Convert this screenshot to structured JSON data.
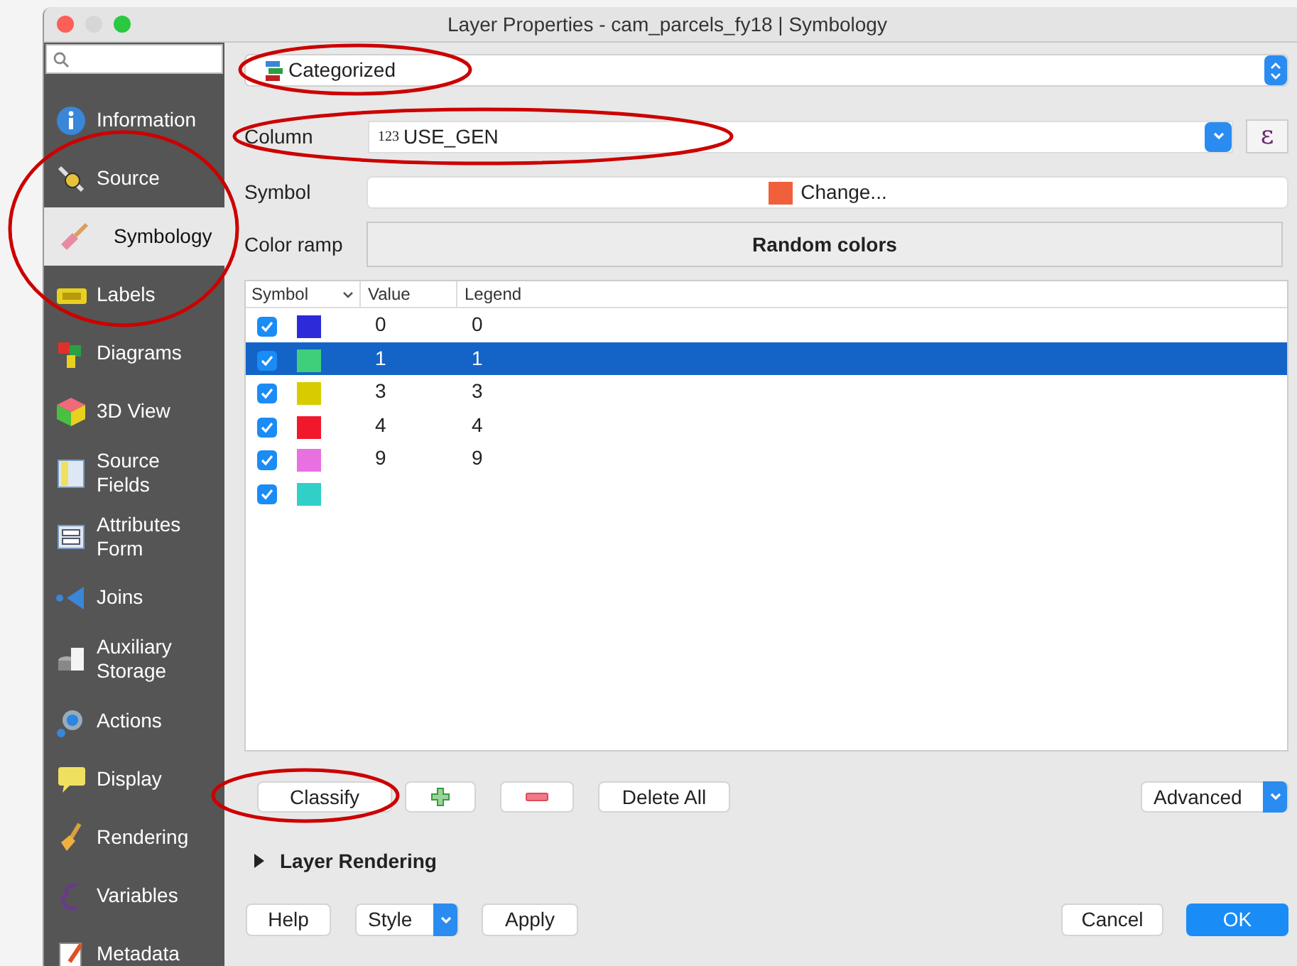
{
  "window": {
    "title": "Layer Properties - cam_parcels_fy18 | Symbology"
  },
  "sidebar": {
    "items": [
      {
        "label": "Information",
        "selected": false
      },
      {
        "label": "Source",
        "selected": false
      },
      {
        "label": "Symbology",
        "selected": true
      },
      {
        "label": "Labels",
        "selected": false
      },
      {
        "label": "Diagrams",
        "selected": false
      },
      {
        "label": "3D View",
        "selected": false
      },
      {
        "label": "Source Fields",
        "selected": false
      },
      {
        "label": "Attributes Form",
        "selected": false
      },
      {
        "label": "Joins",
        "selected": false
      },
      {
        "label": "Auxiliary Storage",
        "selected": false
      },
      {
        "label": "Actions",
        "selected": false
      },
      {
        "label": "Display",
        "selected": false
      },
      {
        "label": "Rendering",
        "selected": false
      },
      {
        "label": "Variables",
        "selected": false
      },
      {
        "label": "Metadata",
        "selected": false
      }
    ]
  },
  "renderer": {
    "value": "Categorized"
  },
  "column": {
    "label": "Column",
    "type_badge": "123",
    "value": "USE_GEN",
    "expression_button": "ε"
  },
  "symbol": {
    "label": "Symbol",
    "button": "Change...",
    "color": "#f0603a"
  },
  "color_ramp": {
    "label": "Color ramp",
    "value": "Random colors"
  },
  "table": {
    "columns": [
      "Symbol",
      "Value",
      "Legend"
    ],
    "rows": [
      {
        "checked": true,
        "color": "#2b2bd9",
        "value": "0",
        "legend": "0",
        "selected": false
      },
      {
        "checked": true,
        "color": "#3fcf7a",
        "value": "1",
        "legend": "1",
        "selected": true
      },
      {
        "checked": true,
        "color": "#d8cc00",
        "value": "3",
        "legend": "3",
        "selected": false
      },
      {
        "checked": true,
        "color": "#f0182a",
        "value": "4",
        "legend": "4",
        "selected": false
      },
      {
        "checked": true,
        "color": "#e870e0",
        "value": "9",
        "legend": "9",
        "selected": false
      },
      {
        "checked": true,
        "color": "#30d0c8",
        "selected": false
      }
    ]
  },
  "actions": {
    "classify": "Classify",
    "delete_all": "Delete All",
    "advanced": "Advanced"
  },
  "layer_rendering": {
    "label": "Layer Rendering",
    "expanded": false
  },
  "footer": {
    "help": "Help",
    "style": "Style",
    "apply": "Apply",
    "cancel": "Cancel",
    "ok": "OK"
  }
}
